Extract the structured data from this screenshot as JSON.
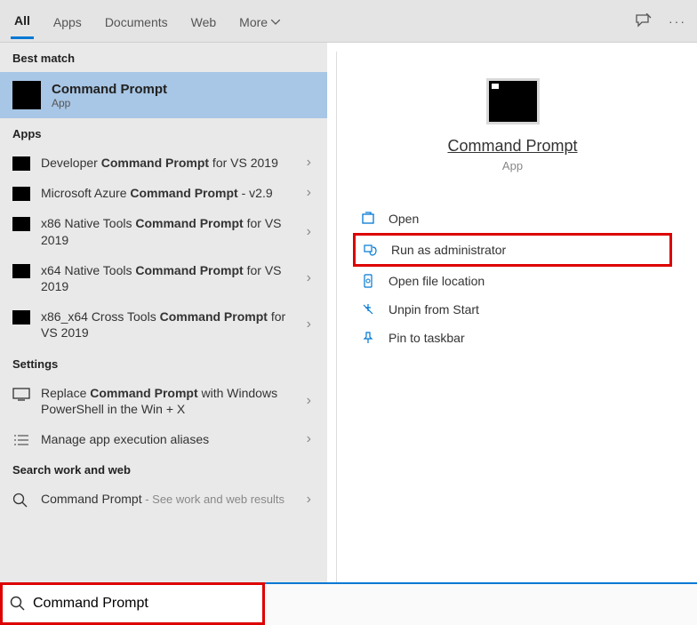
{
  "tabs": {
    "all": "All",
    "apps": "Apps",
    "documents": "Documents",
    "web": "Web",
    "more": "More"
  },
  "sections": {
    "best": "Best match",
    "apps": "Apps",
    "settings": "Settings",
    "workweb": "Search work and web"
  },
  "best": {
    "title": "Command Prompt",
    "sub": "App"
  },
  "apps": [
    {
      "pre": "Developer ",
      "bold": "Command Prompt",
      "post": " for VS 2019"
    },
    {
      "pre": "Microsoft Azure ",
      "bold": "Command Prompt",
      "post": " - v2.9"
    },
    {
      "pre": "x86 Native Tools ",
      "bold": "Command Prompt",
      "post": " for VS 2019"
    },
    {
      "pre": "x64 Native Tools ",
      "bold": "Command Prompt",
      "post": " for VS 2019"
    },
    {
      "pre": "x86_x64 Cross Tools ",
      "bold": "Command Prompt",
      "post": " for VS 2019"
    }
  ],
  "settings": [
    {
      "pre": "Replace ",
      "bold": "Command Prompt",
      "post": " with Windows PowerShell in the Win + X"
    },
    {
      "pre": "Manage app execution aliases",
      "bold": "",
      "post": ""
    }
  ],
  "workweb": {
    "title": "Command Prompt",
    "sub": " - See work and web results"
  },
  "preview": {
    "title": "Command Prompt",
    "sub": "App"
  },
  "actions": {
    "open": "Open",
    "admin": "Run as administrator",
    "loc": "Open file location",
    "unpin": "Unpin from Start",
    "pin": "Pin to taskbar"
  },
  "search": {
    "value": "Command Prompt"
  }
}
